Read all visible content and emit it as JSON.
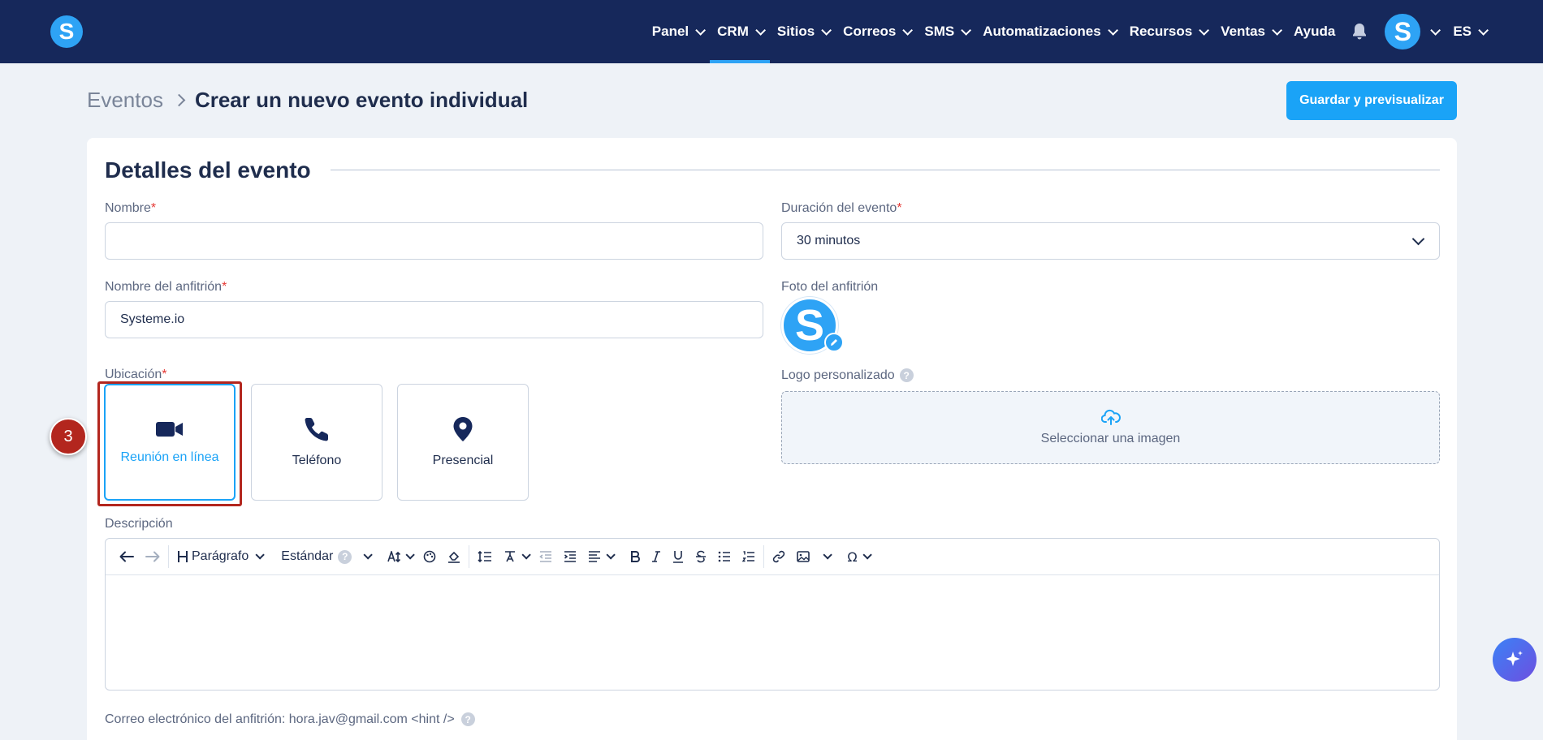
{
  "nav": {
    "items": [
      {
        "label": "Panel",
        "dropdown": true
      },
      {
        "label": "CRM",
        "dropdown": true,
        "active": true
      },
      {
        "label": "Sitios",
        "dropdown": true
      },
      {
        "label": "Correos",
        "dropdown": true
      },
      {
        "label": "SMS",
        "dropdown": true
      },
      {
        "label": "Automatizaciones",
        "dropdown": true
      },
      {
        "label": "Recursos",
        "dropdown": true
      },
      {
        "label": "Ventas",
        "dropdown": true
      },
      {
        "label": "Ayuda",
        "dropdown": false
      }
    ],
    "avatar_letter": "S",
    "language": "ES",
    "logo_letter": "S"
  },
  "breadcrumb": {
    "root": "Eventos",
    "current": "Crear un nuevo evento individual"
  },
  "save_button": "Guardar y previsualizar",
  "card": {
    "title": "Detalles del evento",
    "name_label": "Nombre",
    "name_value": "",
    "duration_label": "Duración del evento",
    "duration_value": "30 minutos",
    "host_name_label": "Nombre del anfitrión",
    "host_name_value": "Systeme.io",
    "host_photo_label": "Foto del anfitrión",
    "host_photo_letter": "S",
    "location_label": "Ubicación",
    "location_options": [
      {
        "label": "Reunión en línea",
        "icon": "video-camera-icon",
        "selected": true
      },
      {
        "label": "Teléfono",
        "icon": "phone-icon",
        "selected": false
      },
      {
        "label": "Presencial",
        "icon": "map-pin-icon",
        "selected": false
      }
    ],
    "logo_label": "Logo personalizado",
    "upload_text": "Seleccionar una imagen",
    "description_label": "Descripción",
    "toolbar": {
      "paragraph": "Parágrafo",
      "font": "Estándar"
    },
    "host_email_line": "Correo electrónico del anfitrión: hora.jav@gmail.com <hint />"
  },
  "annotation": {
    "step_number": "3"
  },
  "colors": {
    "nav_bg": "#16285b",
    "accent": "#1aa3f7",
    "highlight": "#b3261e"
  }
}
